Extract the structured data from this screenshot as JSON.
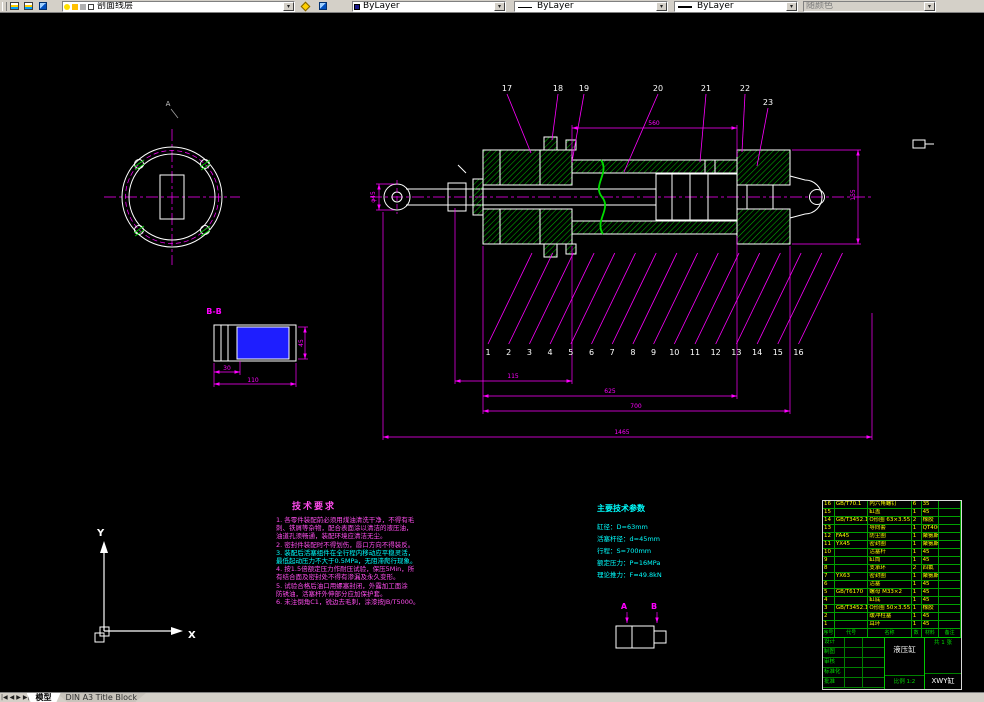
{
  "toolbar": {
    "layer": "剖面线层",
    "color": "ByLayer",
    "linetype": "ByLayer",
    "lineweight": "ByLayer",
    "plot_style": "随颜色"
  },
  "drawing": {
    "view_label_a": "A",
    "section_label": "B-B",
    "detail_ab": {
      "a": "A",
      "b": "B"
    },
    "ucs": {
      "x": "X",
      "y": "Y"
    },
    "callouts_top": [
      "17",
      "18",
      "19",
      "20",
      "21",
      "22",
      "23"
    ],
    "callouts_bottom": [
      "1",
      "2",
      "3",
      "4",
      "5",
      "6",
      "7",
      "8",
      "9",
      "10",
      "11",
      "12",
      "13",
      "14",
      "15",
      "16"
    ],
    "dims": {
      "tube": "560",
      "height": "155",
      "rod": "φ45",
      "d1": "115",
      "d2": "625",
      "d3": "700",
      "total": "1465",
      "bb_a": "30",
      "bb_b": "110",
      "bb_h": "45"
    },
    "tech_notes": {
      "title": "技术要求",
      "lines": [
        {
          "text": "1. 各零件装配前必须用煤油清洗干净，不得有毛",
          "color": "magenta"
        },
        {
          "text": "刺、铁屑等杂物，配合表面涂以清洁的液压油，",
          "color": "magenta"
        },
        {
          "text": "油道孔须畅通，装配环境应清洁无尘。",
          "color": "magenta"
        },
        {
          "text": "2. 密封件装配时不得划伤，唇口方向不得装反。",
          "color": "magenta"
        },
        {
          "text": "3. 装配后活塞组件在全行程内移动应平稳灵活，",
          "color": "cyan"
        },
        {
          "text": "最低起动压力不大于0.5MPa，无阻滞爬行现象。",
          "color": "cyan"
        },
        {
          "text": "4. 按1.5倍额定压力作耐压试验，保压5Min，所",
          "color": "magenta"
        },
        {
          "text": "有结合面及密封处不得有渗漏及永久变形。",
          "color": "magenta"
        },
        {
          "text": "5. 试验合格后油口用螺塞封闭，外露加工面涂",
          "color": "magenta"
        },
        {
          "text": "防锈油，活塞杆外伸部分应加保护套。",
          "color": "magenta"
        },
        {
          "text": "6. 未注倒角C1，锐边去毛刺，涂漆按JB/T5000。",
          "color": "magenta"
        }
      ]
    },
    "parameters": {
      "title": "主要技术参数",
      "lines": [
        "缸径：D=63mm",
        "活塞杆径：d=45mm",
        "行程：S=700mm",
        "额定压力：P=16MPa",
        "理论推力：F≈49.8kN"
      ]
    }
  },
  "title_block": {
    "columns": [
      "序号",
      "代号",
      "名称",
      "数量",
      "材料",
      "备注"
    ],
    "parts": [
      [
        "16",
        "GB/T70.1",
        "内六角螺钉",
        "6",
        "35",
        ""
      ],
      [
        "15",
        "",
        "缸盖",
        "1",
        "45",
        ""
      ],
      [
        "14",
        "GB/T3452.1",
        "O形圈 63×3.55",
        "2",
        "橡胶",
        ""
      ],
      [
        "13",
        "",
        "导向套",
        "1",
        "QT400",
        ""
      ],
      [
        "12",
        "FA45",
        "防尘圈",
        "1",
        "聚氨酯",
        ""
      ],
      [
        "11",
        "YX45",
        "密封圈",
        "1",
        "聚氨酯",
        ""
      ],
      [
        "10",
        "",
        "活塞杆",
        "1",
        "45",
        ""
      ],
      [
        "9",
        "",
        "缸筒",
        "1",
        "45",
        ""
      ],
      [
        "8",
        "",
        "支承环",
        "2",
        "四氟",
        ""
      ],
      [
        "7",
        "YX63",
        "密封圈",
        "1",
        "聚氨酯",
        ""
      ],
      [
        "6",
        "",
        "活塞",
        "1",
        "45",
        ""
      ],
      [
        "5",
        "GB/T6170",
        "螺母 M33×2",
        "1",
        "45",
        ""
      ],
      [
        "4",
        "",
        "缸底",
        "1",
        "45",
        ""
      ],
      [
        "3",
        "GB/T3452.1",
        "O形圈 50×3.55",
        "1",
        "橡胶",
        ""
      ],
      [
        "2",
        "",
        "缓冲柱塞",
        "1",
        "45",
        ""
      ],
      [
        "1",
        "",
        "耳环",
        "1",
        "45",
        ""
      ]
    ],
    "roles": [
      "设计",
      "制图",
      "审核",
      "标准化",
      "批准"
    ],
    "name": "液压缸",
    "scale_label": "比例",
    "scale": "1:2",
    "sheet": "共 1 张",
    "dwg_no": "XWY缸"
  },
  "tabs": {
    "model": "模型",
    "layout": "DIN A3 Title Block"
  }
}
